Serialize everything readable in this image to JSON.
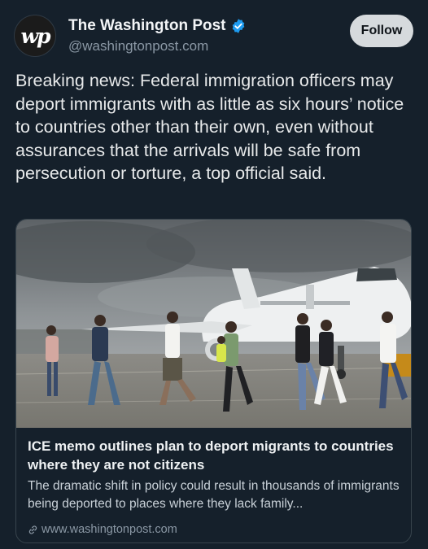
{
  "account": {
    "avatar_text": "wp",
    "display_name": "The Washington Post",
    "handle": "@washingtonpost.com",
    "verified": true
  },
  "actions": {
    "follow_label": "Follow"
  },
  "post": {
    "text": "Breaking news: Federal immigration officers may deport immigrants with as little as six hours’ notice to countries other than their own, even without assurances that the arrivals will be safe from persecution or torture, a top official said."
  },
  "link_card": {
    "title": "ICE memo outlines plan to deport migrants to countries where they are not citizens",
    "description": "The dramatic shift in policy could result in thousands of immigrants being deported to places where they lack family...",
    "domain": "www.washingtonpost.com",
    "image_icon": "photo-deportees-walking-to-airplane"
  },
  "colors": {
    "background": "#15202b",
    "verified_badge": "#1d9bf0",
    "follow_button": "#d6dadd",
    "muted_text": "#8b98a5"
  }
}
